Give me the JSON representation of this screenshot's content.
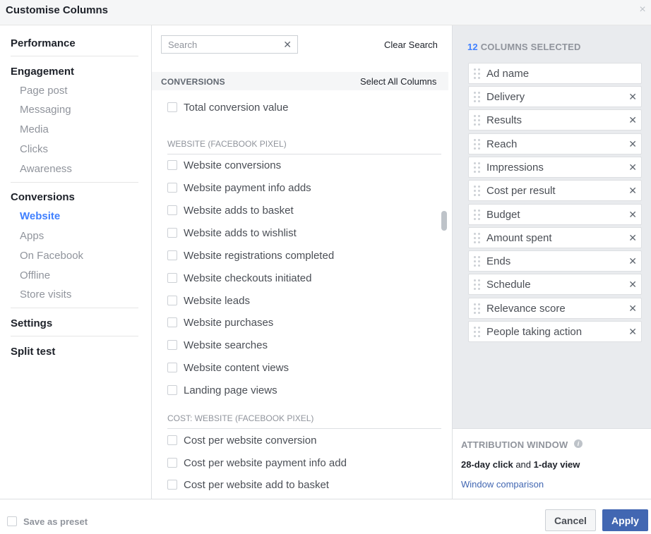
{
  "window": {
    "title": "Customise Columns",
    "close_icon": "×"
  },
  "nav": {
    "performance": "Performance",
    "engagement": "Engagement",
    "engagement_items": [
      "Page post",
      "Messaging",
      "Media",
      "Clicks",
      "Awareness"
    ],
    "conversions": "Conversions",
    "conversions_items": [
      "Website",
      "Apps",
      "On Facebook",
      "Offline",
      "Store visits"
    ],
    "active_item": "Website",
    "settings": "Settings",
    "split_test": "Split test"
  },
  "search": {
    "placeholder": "Search",
    "value": "",
    "clear_icon": "✕",
    "clear_label": "Clear Search"
  },
  "section": {
    "label": "CONVERSIONS",
    "select_all": "Select All Columns"
  },
  "metrics": {
    "top": [
      "Total conversion value"
    ],
    "website_header": "WEBSITE (FACEBOOK PIXEL)",
    "website": [
      "Website conversions",
      "Website payment info adds",
      "Website adds to basket",
      "Website adds to wishlist",
      "Website registrations completed",
      "Website checkouts initiated",
      "Website leads",
      "Website purchases",
      "Website searches",
      "Website content views",
      "Landing page views"
    ],
    "cost_header": "COST: WEBSITE (FACEBOOK PIXEL)",
    "cost": [
      "Cost per website conversion",
      "Cost per website payment info add",
      "Cost per website add to basket"
    ]
  },
  "selected": {
    "count": "12",
    "label": "COLUMNS SELECTED",
    "remove_icon": "✕",
    "columns": [
      "Ad name",
      "Delivery",
      "Results",
      "Reach",
      "Impressions",
      "Cost per result",
      "Budget",
      "Amount spent",
      "Ends",
      "Schedule",
      "Relevance score",
      "People taking action"
    ]
  },
  "attribution": {
    "title": "ATTRIBUTION WINDOW",
    "info_icon": "i",
    "click": "28-day click",
    "and": " and ",
    "view": "1-day view",
    "link": "Window comparison"
  },
  "footer": {
    "save_preset": "Save as preset",
    "cancel": "Cancel",
    "apply": "Apply"
  },
  "colors": {
    "accent": "#4080ff",
    "primary_button": "#4267b2",
    "panel_bg": "#e9ebee",
    "muted_text": "#90949c"
  }
}
